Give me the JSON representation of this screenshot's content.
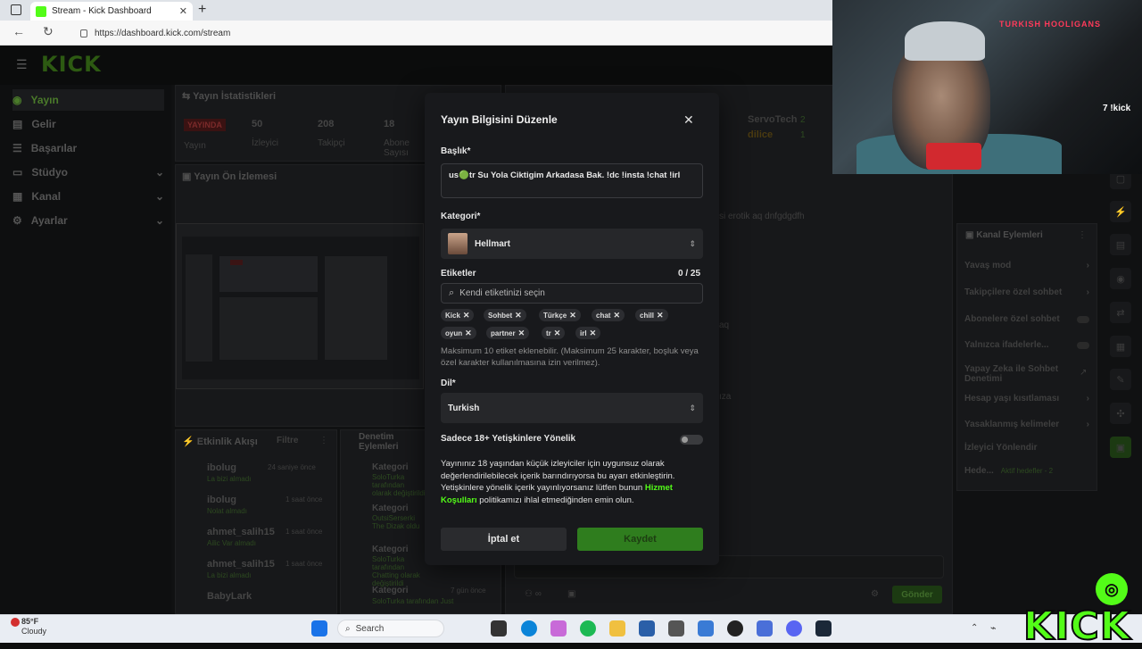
{
  "browser": {
    "tab_title": "Stream - Kick Dashboard",
    "url": "https://dashboard.kick.com/stream"
  },
  "dashboard": {
    "logo": "KICK",
    "nav": [
      {
        "label": "Yayın"
      },
      {
        "label": "Gelir"
      },
      {
        "label": "Başarılar"
      },
      {
        "label": "Stüdyo"
      },
      {
        "label": "Kanal"
      },
      {
        "label": "Ayarlar"
      }
    ],
    "stats_panel": {
      "title": "Yayın İstatistikleri",
      "live_badge": "YAYINDA",
      "live_label": "Yayın",
      "viewers_value": "50",
      "viewers_label": "İzleyici",
      "followers_value": "208",
      "followers_label": "Takipçi",
      "subs_value": "18",
      "subs_label": "Abone Sayısı"
    },
    "preview_panel": {
      "title": "Yayın Ön İzlemesi"
    },
    "activity_panel": {
      "title": "Etkinlik Akışı",
      "filter_label": "Filtre",
      "items": [
        {
          "user": "ibolug",
          "sub": "La bizi almadı",
          "time": "24 saniye önce"
        },
        {
          "user": "ibolug",
          "sub": "Nolat almadı",
          "time": "1 saat önce"
        },
        {
          "user": "ahmet_salih15",
          "sub": "Ailic Var almadı",
          "time": "1 saat önce"
        },
        {
          "user": "ahmet_salih15",
          "sub": "La bizi almadı",
          "time": "1 saat önce"
        },
        {
          "user": "BabyLark",
          "sub": "",
          "time": ""
        }
      ]
    },
    "moderation_panel": {
      "title": "Denetim Eylemleri",
      "items": [
        {
          "title": "Kategori",
          "sub": "SoloTurka tarafından olarak değiştirildi"
        },
        {
          "title": "Kategori",
          "sub": "OutsiSerserki The Dizak oldu"
        },
        {
          "title": "Kategori",
          "sub": "SoloTurka tarafından Chatting olarak değiştirildi"
        },
        {
          "title": "Kategori",
          "sub": "SoloTurka tarafından Just",
          "time": "7 gün önce"
        }
      ]
    },
    "chat_panel": {
      "users": [
        {
          "name": "ServoTech",
          "count": "2"
        },
        {
          "name": "dilice",
          "count": "1"
        }
      ],
      "messages": [
        "si erotik aq dnfgdgdfh",
        "aq",
        "ıza"
      ],
      "send_label": "Gönder"
    },
    "channel_actions": {
      "title": "Kanal Eylemleri",
      "items": [
        {
          "label": "Yavaş mod",
          "kind": "chevron"
        },
        {
          "label": "Takipçilere özel sohbet",
          "kind": "chevron"
        },
        {
          "label": "Abonelere özel sohbet",
          "kind": "toggle"
        },
        {
          "label": "Yalnızca ifadelerle...",
          "kind": "toggle"
        },
        {
          "label": "Yapay Zeka ile Sohbet Denetimi",
          "kind": "external"
        },
        {
          "label": "Hesap yaşı kısıtlaması",
          "kind": "chevron"
        },
        {
          "label": "Yasaklanmış kelimeler",
          "kind": "chevron"
        },
        {
          "label": "İzleyici Yönlendir",
          "kind": "none"
        },
        {
          "label": "Hede...",
          "kind": "none",
          "note": "Aktif hedefler - 2"
        }
      ]
    }
  },
  "modal": {
    "title": "Yayın Bilgisini Düzenle",
    "title_label": "Başlık*",
    "title_value": "us🟢tr Su Yola Ciktigim Arkadasa Bak. !dc !insta !chat !irl",
    "category_label": "Kategori*",
    "category_value": "Hellmart",
    "tags_label": "Etiketler",
    "tags_count": "0 / 25",
    "tags_placeholder": "Kendi etiketinizi seçin",
    "tags": [
      "Kick",
      "Sohbet",
      "Türkçe",
      "chat",
      "chill",
      "oyun",
      "partner",
      "tr",
      "irl"
    ],
    "tags_hint": "Maksimum 10 etiket eklenebilir. (Maksimum 25 karakter, boşluk veya özel karakter kullanılmasına izin verilmez).",
    "language_label": "Dil*",
    "language_value": "Turkish",
    "adult_label": "Sadece 18+ Yetişkinlere Yönelik",
    "adult_enabled": false,
    "adult_text_before": "Yayınınız 18 yaşından küçük izleyiciler için uygunsuz olarak değerlendirilebilecek içerik barındırıyorsa bu ayarı etkinleştirin. Yetişkinlere yönelik içerik yayınlıyorsanız lütfen bunun ",
    "adult_link": "Hizmet Koşulları",
    "adult_text_after": " politikamızı ihlal etmediğinden emin olun.",
    "cancel_label": "İptal et",
    "save_label": "Kaydet"
  },
  "webcam": {
    "neon_text": "TURKISH HOOLIGANS",
    "neon_text2": "7 !kick"
  },
  "taskbar": {
    "weather_temp": "85°F",
    "weather_desc": "Cloudy",
    "search_label": "Search"
  },
  "overlay": {
    "kick_logo": "KICK"
  },
  "colors": {
    "accent": "#53fc18",
    "save_button": "#2f7d1e",
    "link": "#53fc18",
    "modal_bg": "#18191c"
  }
}
